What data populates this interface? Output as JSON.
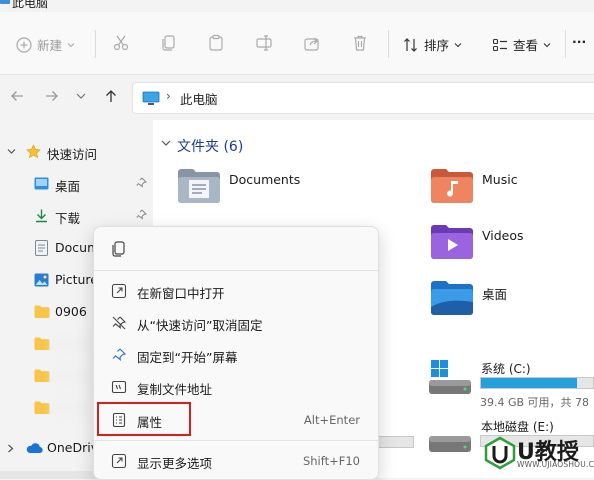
{
  "window": {
    "title": "此电脑"
  },
  "toolbar": {
    "new_label": "新建",
    "sort_label": "排序",
    "view_label": "查看",
    "more_label": "···"
  },
  "address": {
    "path": "此电脑"
  },
  "sidebar": {
    "quick_access": "快速访问",
    "items": [
      {
        "label": "桌面"
      },
      {
        "label": "下载"
      },
      {
        "label": "Docum"
      },
      {
        "label": "Picture"
      },
      {
        "label": "0906"
      }
    ],
    "onedrive": "OneDriv"
  },
  "main": {
    "folders_header": "文件夹 (6)",
    "folders": [
      {
        "name": "Documents"
      },
      {
        "name": "Music"
      },
      {
        "name": "Videos"
      },
      {
        "name": "桌面"
      }
    ],
    "drives": [
      {
        "name": "系统 (C:)",
        "free": "39.4 GB 可用，共 78",
        "used_fraction": 0.86
      },
      {
        "name": "本地磁盘 (E:)"
      }
    ]
  },
  "context_menu": {
    "items": [
      {
        "label": "在新窗口中打开",
        "shortcut": ""
      },
      {
        "label": "从“快速访问”取消固定",
        "shortcut": ""
      },
      {
        "label": "固定到“开始”屏幕",
        "shortcut": ""
      },
      {
        "label": "复制文件地址",
        "shortcut": ""
      },
      {
        "label": "属性",
        "shortcut": "Alt+Enter"
      },
      {
        "label": "显示更多选项",
        "shortcut": "Shift+F10"
      }
    ]
  },
  "watermark": {
    "brand": "U教授",
    "url": "WWW.UJIAOSHOU.COM"
  },
  "colors": {
    "accent": "#26a0da",
    "highlight_border": "#d81e1e",
    "group_title": "#1f3d8c",
    "brand_green": "#2e9e3a"
  }
}
